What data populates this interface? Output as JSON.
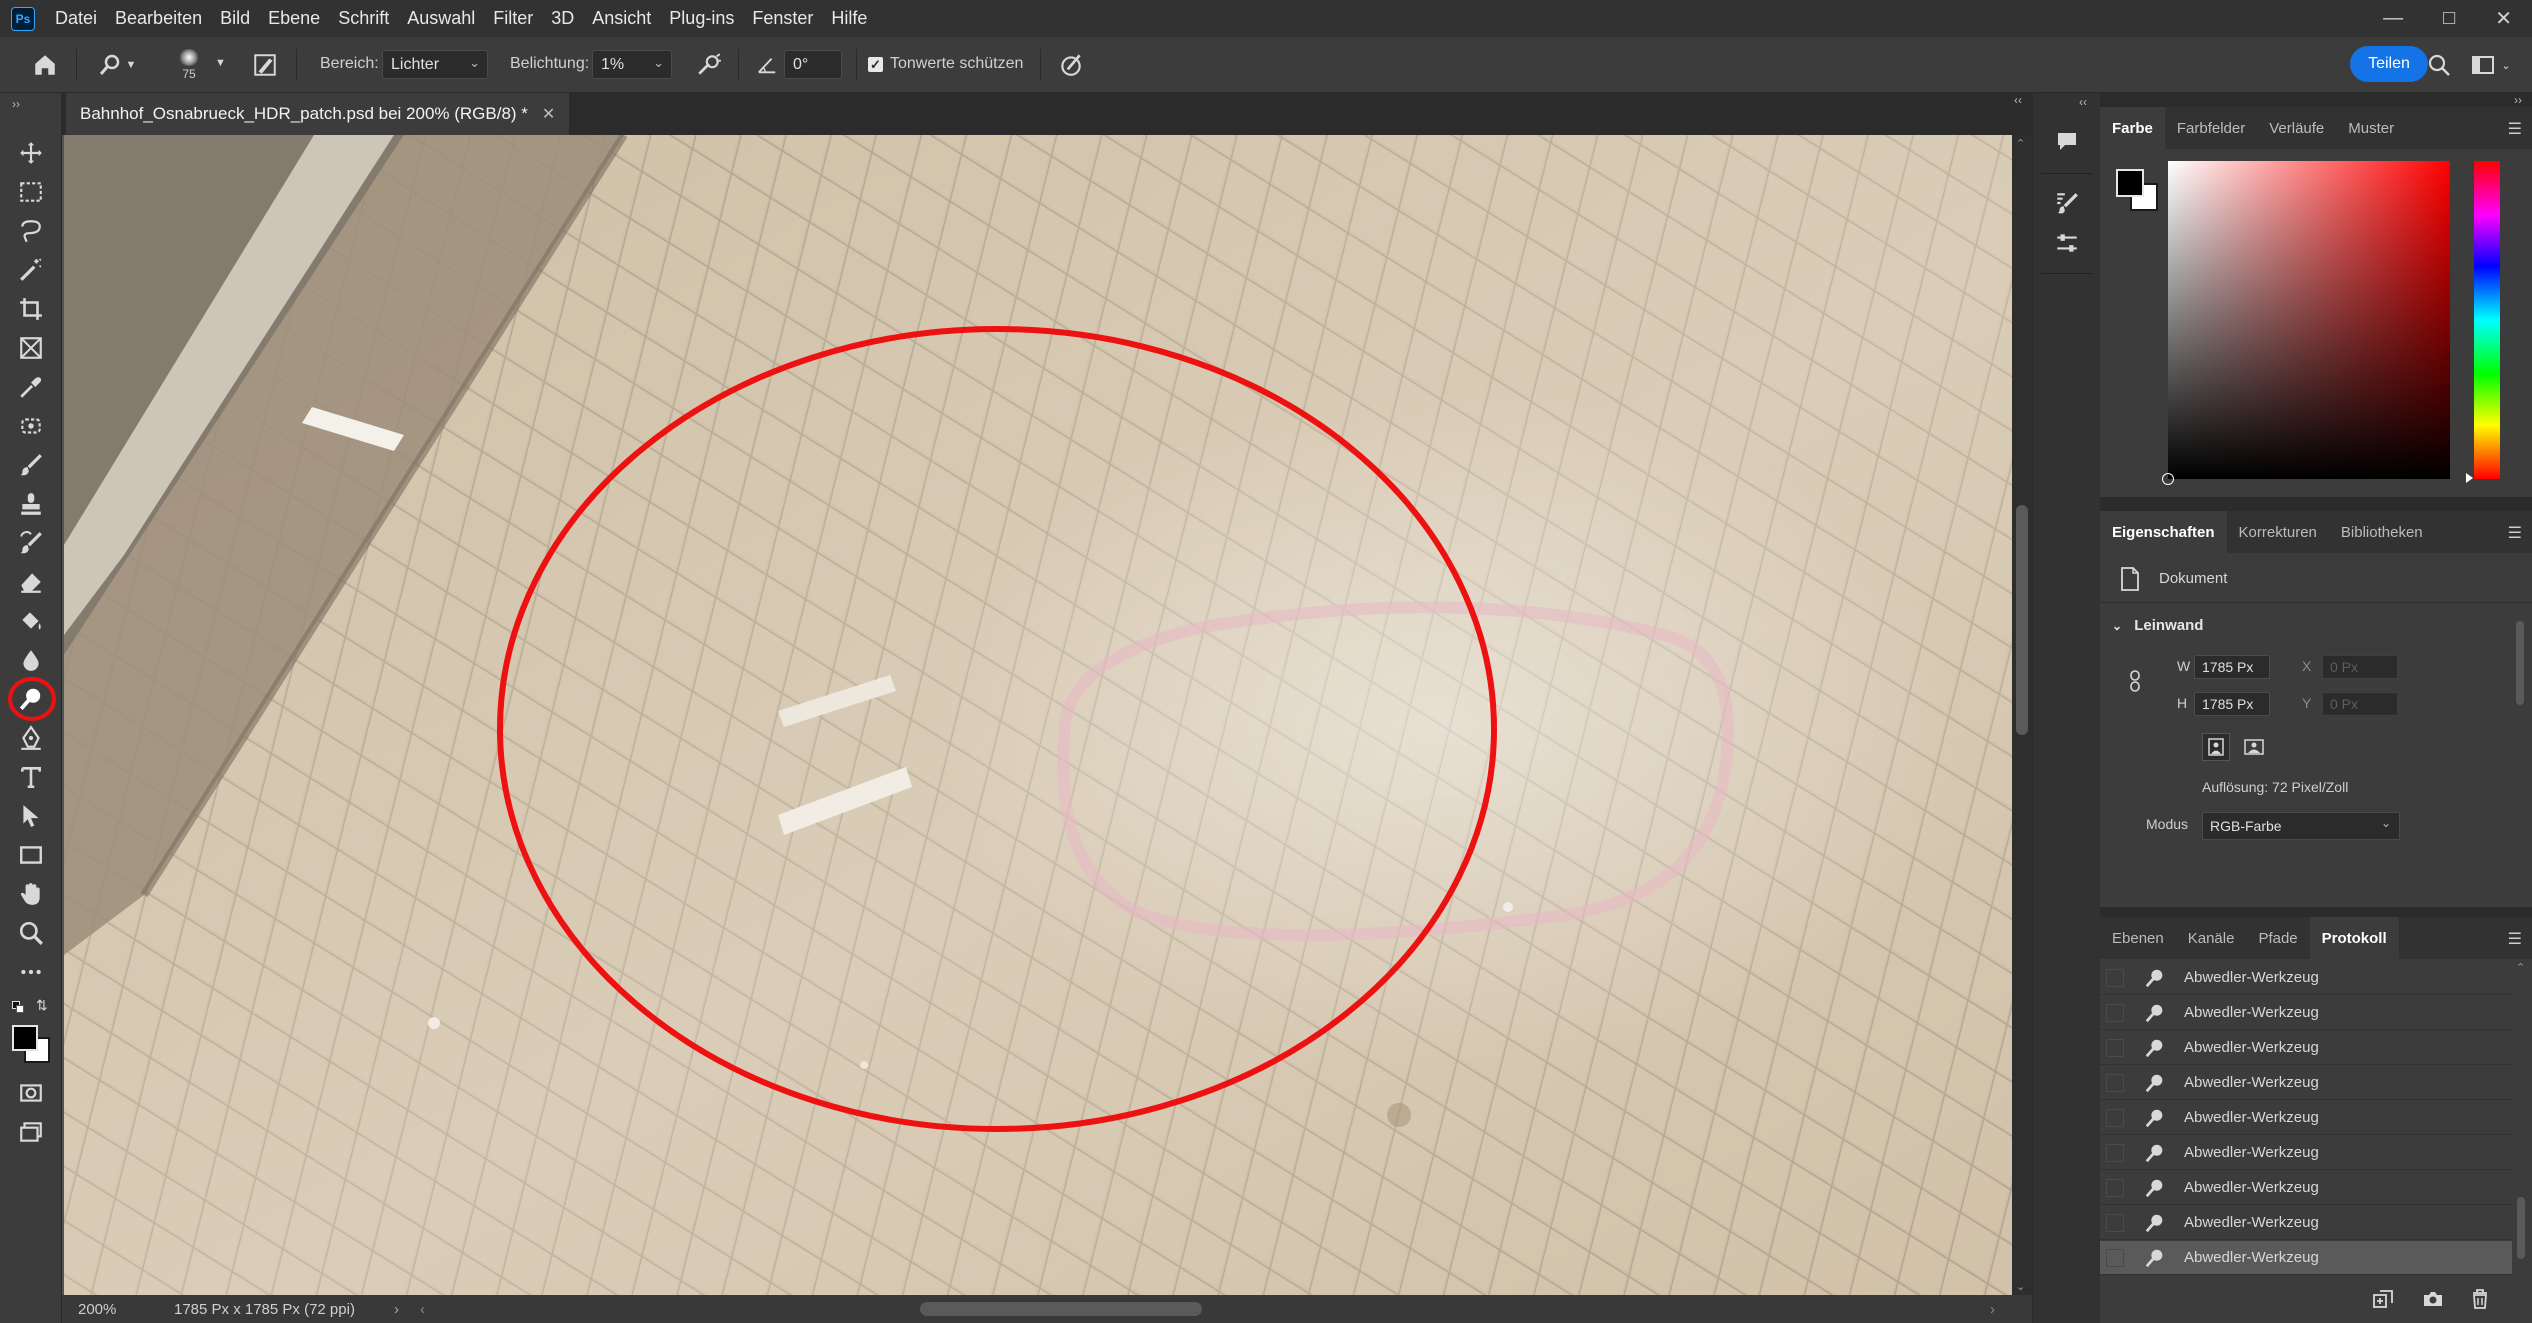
{
  "app": {
    "logo": "Ps",
    "menu": [
      "Datei",
      "Bearbeiten",
      "Bild",
      "Ebene",
      "Schrift",
      "Auswahl",
      "Filter",
      "3D",
      "Ansicht",
      "Plug-ins",
      "Fenster",
      "Hilfe"
    ],
    "window_controls": [
      "minimize-icon",
      "restore-icon",
      "close-icon"
    ]
  },
  "options_bar": {
    "brush_size": "75",
    "range_label": "Bereich:",
    "range_value": "Lichter",
    "exposure_label": "Belichtung:",
    "exposure_value": "1%",
    "angle_value": "0°",
    "protect_tones_label": "Tonwerte schützen",
    "protect_tones_checked": true,
    "share_label": "Teilen"
  },
  "document": {
    "tab_title": "Bahnhof_Osnabrueck_HDR_patch.psd bei 200% (RGB/8) *",
    "zoom": "200%",
    "doc_info": "1785 Px x 1785 Px (72 ppi)"
  },
  "color_panel": {
    "tabs": [
      "Farbe",
      "Farbfelder",
      "Verläufe",
      "Muster"
    ],
    "active_tab": "Farbe",
    "foreground": "#000000",
    "background": "#ffffff",
    "hue": "#ff0000"
  },
  "properties_panel": {
    "tabs": [
      "Eigenschaften",
      "Korrekturen",
      "Bibliotheken"
    ],
    "active_tab": "Eigenschaften",
    "type_label": "Dokument",
    "section_title": "Leinwand",
    "w_label": "W",
    "w_value": "1785 Px",
    "h_label": "H",
    "h_value": "1785 Px",
    "x_label": "X",
    "x_value": "0 Px",
    "y_label": "Y",
    "y_value": "0 Px",
    "resolution": "Auflösung: 72 Pixel/Zoll",
    "mode_label": "Modus",
    "mode_value": "RGB-Farbe"
  },
  "history_panel": {
    "tabs": [
      "Ebenen",
      "Kanäle",
      "Pfade",
      "Protokoll"
    ],
    "active_tab": "Protokoll",
    "items": [
      "Abwedler-Werkzeug",
      "Abwedler-Werkzeug",
      "Abwedler-Werkzeug",
      "Abwedler-Werkzeug",
      "Abwedler-Werkzeug",
      "Abwedler-Werkzeug",
      "Abwedler-Werkzeug",
      "Abwedler-Werkzeug",
      "Abwedler-Werkzeug"
    ],
    "active_index": 8
  },
  "toolbar": {
    "tools": [
      "move-tool",
      "marquee-tool",
      "lasso-tool",
      "magic-wand-tool",
      "crop-tool",
      "frame-tool",
      "eyedropper-tool",
      "patch-tool",
      "brush-tool",
      "clone-stamp-tool",
      "history-brush-tool",
      "eraser-tool",
      "paint-bucket-tool",
      "blur-tool",
      "dodge-tool",
      "pen-tool",
      "type-tool",
      "path-selection-tool",
      "rectangle-tool",
      "hand-tool",
      "zoom-tool",
      "more-tools"
    ],
    "active_tool": "dodge-tool"
  },
  "annotation": {
    "color": "#ee1111"
  }
}
